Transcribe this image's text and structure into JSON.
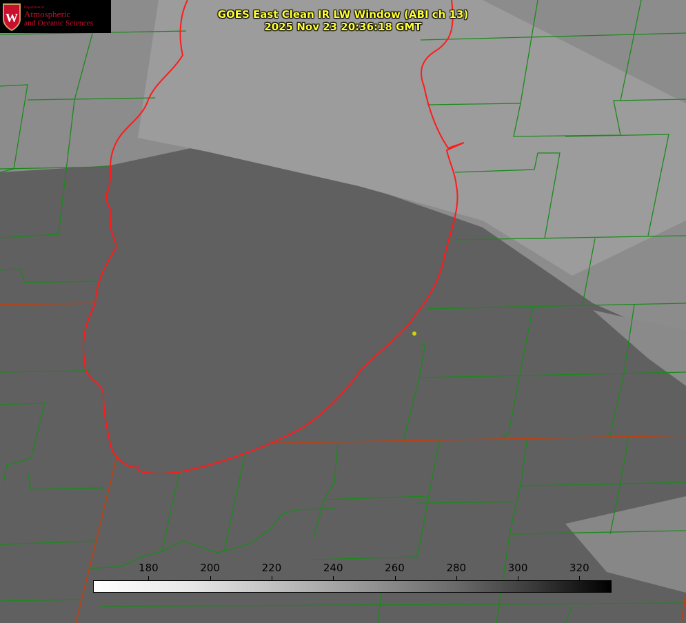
{
  "title": {
    "line1": "GOES East Clean IR LW Window (ABI ch 13)",
    "line2": "2025 Nov 23 20:36:18 GMT"
  },
  "logo": {
    "dept": "Department of",
    "line1": "Atmospheric",
    "line2": "and Oceanic Sciences",
    "letter": "W"
  },
  "colorbar": {
    "ticks": [
      "180",
      "200",
      "220",
      "240",
      "260",
      "280",
      "300",
      "320"
    ],
    "tick_values": [
      180,
      200,
      220,
      240,
      260,
      280,
      300,
      320
    ],
    "range": [
      162,
      330
    ],
    "colormap": "white-to-black"
  },
  "colors": {
    "title": "#ffff33",
    "county_lines": "#1a8a1a",
    "coastline": "#ff2020",
    "marker": "#d4d400"
  }
}
